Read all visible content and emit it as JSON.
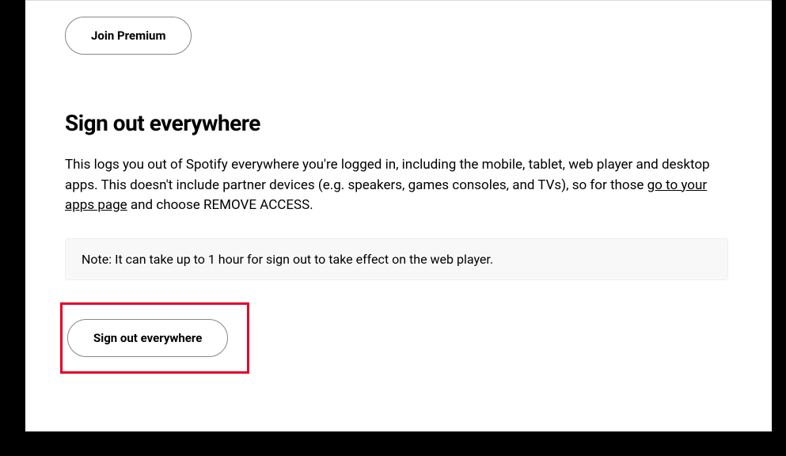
{
  "buttons": {
    "join_premium_label": "Join Premium",
    "sign_out_everywhere_label": "Sign out everywhere"
  },
  "section": {
    "heading": "Sign out everywhere",
    "description_part1": "This logs you out of Spotify everywhere you're logged in, including the mobile, tablet, web player and desktop apps. This doesn't include partner devices (e.g. speakers, games consoles, and TVs), so for those ",
    "link_text": "go to your apps page",
    "description_part2": " and choose REMOVE ACCESS.",
    "note": "Note: It can take up to 1 hour for sign out to take effect on the web player."
  }
}
